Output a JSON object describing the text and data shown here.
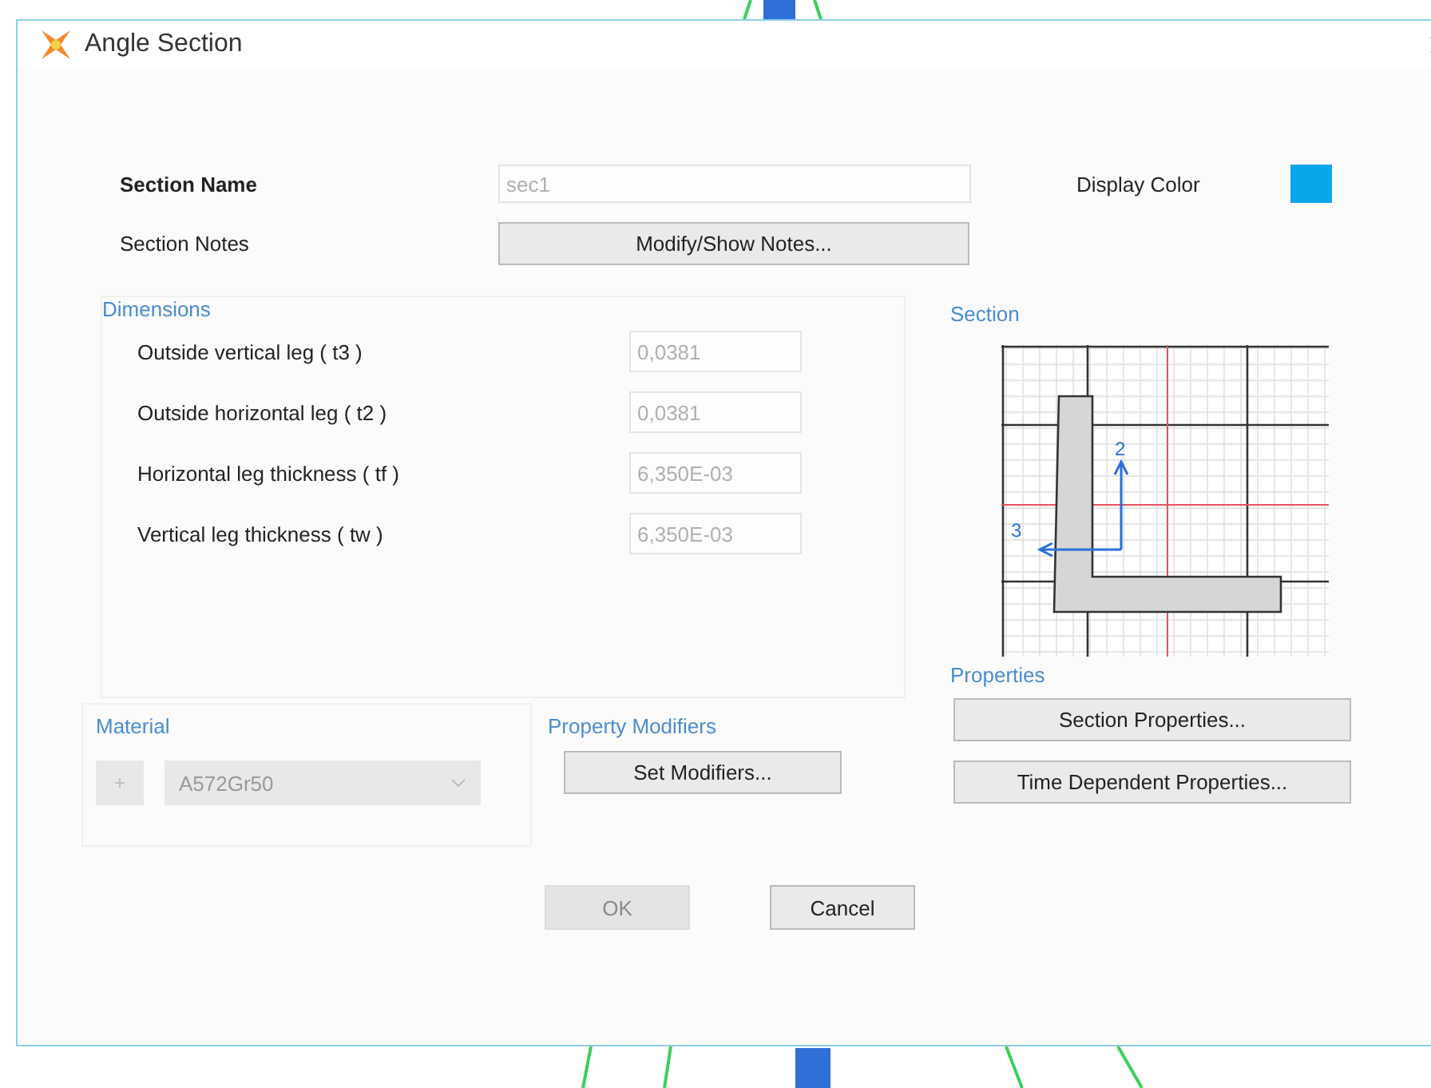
{
  "window": {
    "title": "Angle Section"
  },
  "section_name": {
    "label": "Section Name",
    "value": "sec1",
    "disabled": true
  },
  "display_color": {
    "label": "Display Color",
    "color": "#0aa6ea"
  },
  "section_notes": {
    "label": "Section Notes",
    "button": "Modify/Show Notes..."
  },
  "dimensions": {
    "title": "Dimensions",
    "rows": [
      {
        "label": "Outside vertical leg  ( t3 )",
        "value": "0,0381",
        "disabled": true
      },
      {
        "label": "Outside horizontal leg  ( t2 )",
        "value": "0,0381",
        "disabled": true
      },
      {
        "label": "Horizontal leg thickness  ( tf )",
        "value": "6,350E-03",
        "disabled": true
      },
      {
        "label": "Vertical leg thickness  ( tw )",
        "value": "6,350E-03",
        "disabled": true
      }
    ]
  },
  "section": {
    "title": "Section",
    "axis_labels": [
      "2",
      "3"
    ]
  },
  "material": {
    "title": "Material",
    "button": "+",
    "value": "A572Gr50",
    "disabled": true
  },
  "property_modifiers": {
    "title": "Property Modifiers",
    "button": "Set Modifiers..."
  },
  "properties": {
    "title": "Properties",
    "buttons": [
      "Section Properties...",
      "Time Dependent Properties..."
    ]
  },
  "footer": [
    {
      "label": "OK",
      "disabled": true
    },
    {
      "label": "Cancel",
      "disabled": false
    }
  ]
}
